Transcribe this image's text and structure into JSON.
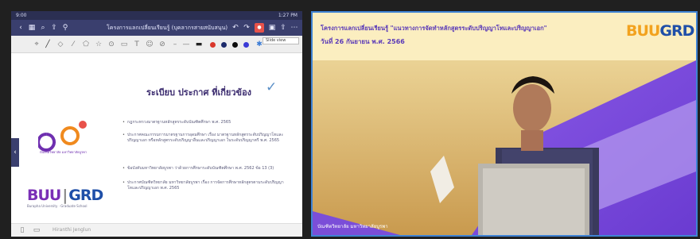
{
  "left_tile": {
    "status_time": "9:00",
    "status_right": "1:27 PM",
    "title": "โครงการแลกเปลี่ยนเรียนรู้ (บุคลากรสายสนับสนุน)",
    "toolbar_dropdown": "Slide view",
    "slide": {
      "heading": "ระเบียบ ประกาศ ที่เกี่ยวข้อง",
      "bullets": [
        "กฎกระทรวงมาตรฐานหลักสูตรระดับบัณฑิตศึกษา พ.ศ. 2565",
        "ประกาศคณะกรรมการมาตรฐานการอุดมศึกษา เรื่อง มาตรฐานหลักสูตรระดับปริญญาโทและปริญญาเอก หรือหลักสูตรระดับปริญญาอื่นและปริญญาเอก ในระดับปริญญาตรี พ.ศ. 2565",
        "ข้อบังคับมหาวิทยาลัยบูรพา ว่าด้วยการศึกษาระดับบัณฑิตศึกษา พ.ศ. 2562 ข้อ 13 (3)",
        "ประกาศบัณฑิตวิทยาลัย มหาวิทยาลัยบูรพา เรื่อง การจัดการศึกษาหลักสูตรตามระดับปริญญาโทและปริญญาเอก พ.ศ. 2565"
      ],
      "logo_left_caption": "บัณฑิตวิทยาลัย มหาวิทยาลัยบูรพา",
      "buu_text": "BUU",
      "grd_text": "GRD",
      "buu_caption": "Burapha University · Graduate School"
    },
    "presenter_name": "Hiranthi Jenglun"
  },
  "right_tile": {
    "banner_title": "โครงการแลกเปลี่ยนเรียนรู้ \"แนวทางการจัดทำหลักสูตรระดับปริญญาโทและปริญญาเอก\"",
    "banner_date": "วันที่ 26 กันยายน พ.ศ. 2566",
    "logo_buu": "BUU",
    "logo_grd": "GRD",
    "speaker_caption": "บัณฑิตวิทยาลัย มหาวิทยาลัยบูรพา"
  },
  "colors": {
    "accent_purple": "#5a3ab8",
    "banner_yellow": "#fbeec0",
    "tab_bar": "#3a3f6e",
    "active_border": "#3f83d4"
  }
}
